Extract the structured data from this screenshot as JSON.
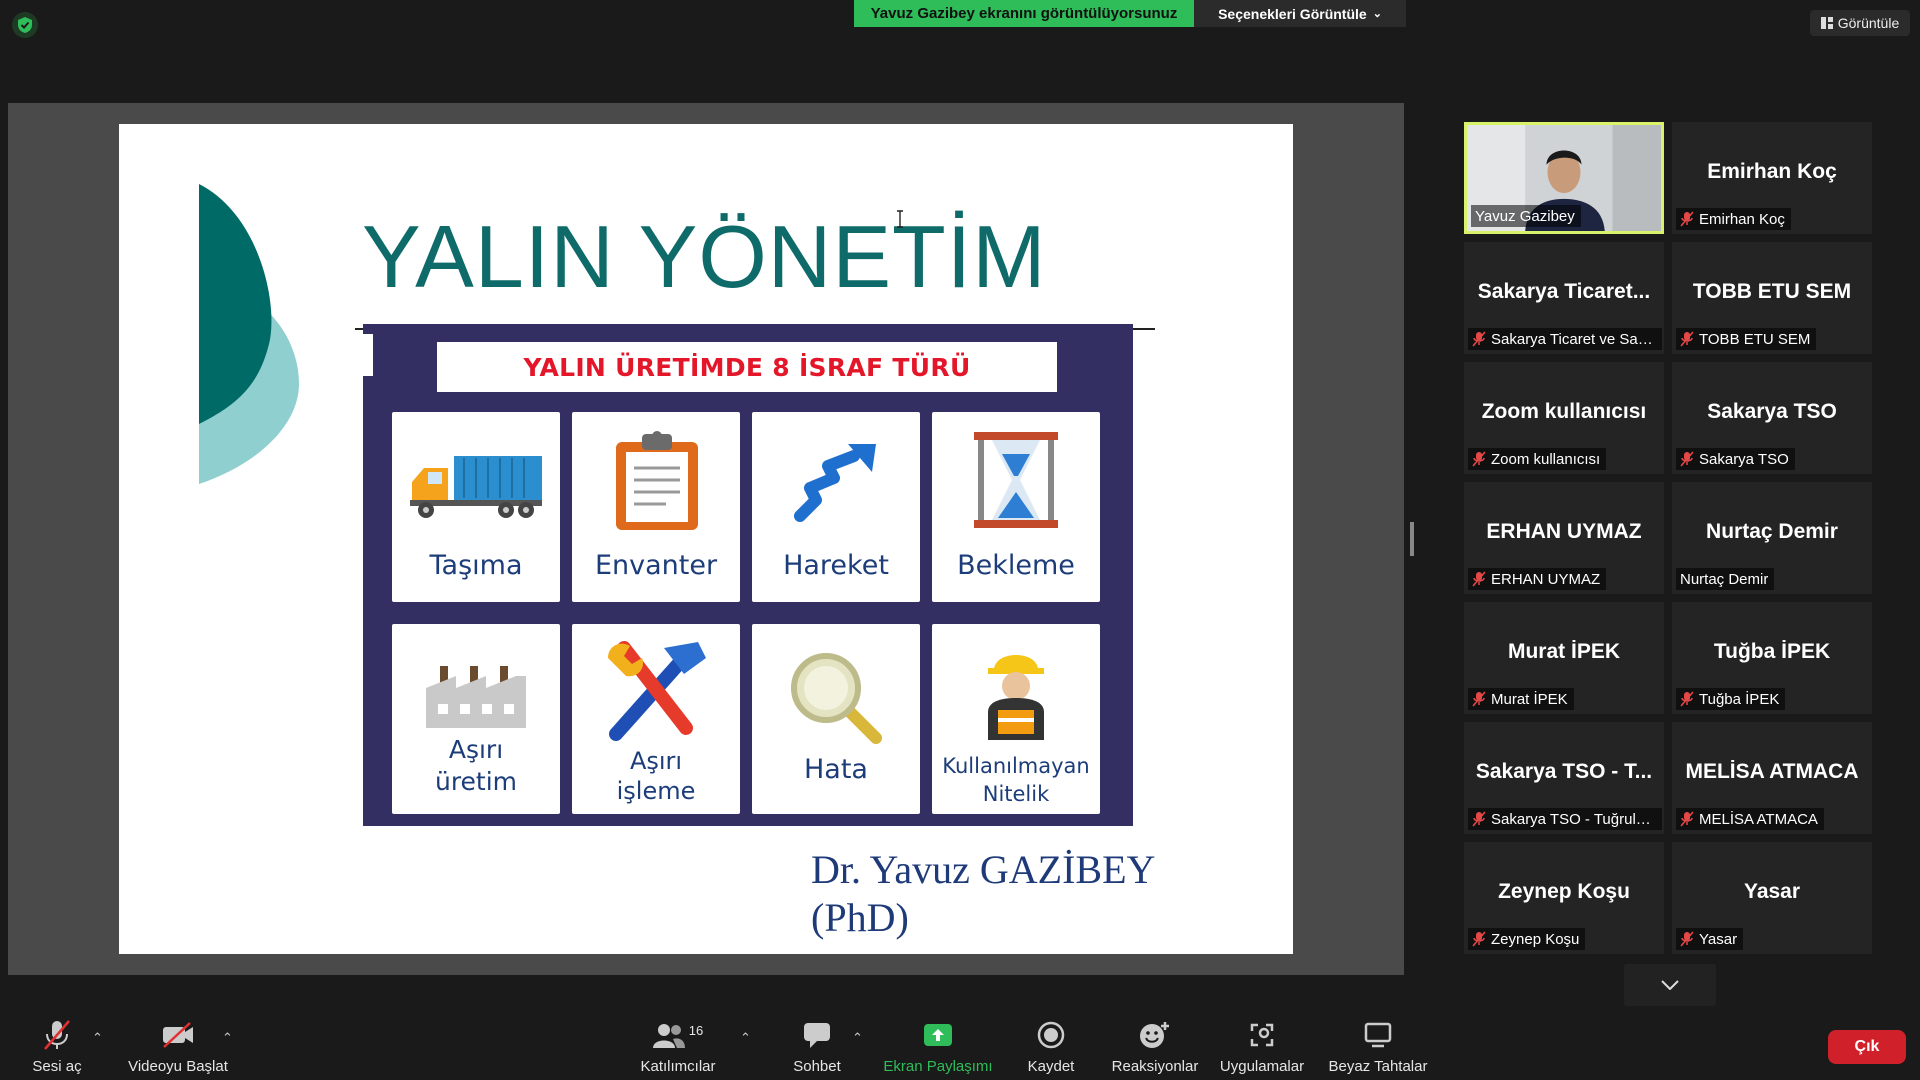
{
  "top_bar": {
    "share_banner": "Yavuz Gazibey ekranını görüntülüyorsunuz",
    "view_options": "Seçenekleri Görüntüle",
    "view_button": "Görüntüle"
  },
  "slide": {
    "title": "YALIN YÖNETİM",
    "panel_header": "YALIN ÜRETİMDE 8 İSRAF TÜRÜ",
    "cards": [
      {
        "label": "Taşıma",
        "icon": "truck-icon"
      },
      {
        "label": "Envanter",
        "icon": "clipboard-icon"
      },
      {
        "label": "Hareket",
        "icon": "zigzag-arrow-icon"
      },
      {
        "label": "Bekleme",
        "icon": "hourglass-icon"
      },
      {
        "label_line1": "Aşırı",
        "label_line2": "üretim",
        "icon": "factory-icon"
      },
      {
        "label_line1": "Aşırı",
        "label_line2": "işleme",
        "icon": "tools-icon"
      },
      {
        "label": "Hata",
        "icon": "magnifier-icon"
      },
      {
        "label_line1": "Kullanılmayan",
        "label_line2": "Nitelik",
        "icon": "worker-icon"
      }
    ],
    "author_line1": "Dr. Yavuz GAZİBEY",
    "author_line2": "(PhD)"
  },
  "gallery": [
    {
      "big": "",
      "tag": "Yavuz Gazibey",
      "muted": false,
      "video": true
    },
    {
      "big": "Emirhan Koç",
      "tag": "Emirhan Koç",
      "muted": true
    },
    {
      "big": "Sakarya  Ticaret...",
      "tag": "Sakarya Ticaret ve San...",
      "muted": true
    },
    {
      "big": "TOBB ETU SEM",
      "tag": "TOBB ETU SEM",
      "muted": true
    },
    {
      "big": "Zoom kullanıcısı",
      "tag": "Zoom kullanıcısı",
      "muted": true
    },
    {
      "big": "Sakarya TSO",
      "tag": "Sakarya TSO",
      "muted": true
    },
    {
      "big": "ERHAN UYMAZ",
      "tag": "ERHAN UYMAZ",
      "muted": true
    },
    {
      "big": "Nurtaç Demir",
      "tag": "Nurtaç Demir",
      "muted": false
    },
    {
      "big": "Murat İPEK",
      "tag": "Murat İPEK",
      "muted": true
    },
    {
      "big": "Tuğba İPEK",
      "tag": "Tuğba İPEK",
      "muted": true
    },
    {
      "big": "Sakarya TSO - T...",
      "tag": "Sakarya TSO - Tuğrulh...",
      "muted": true
    },
    {
      "big": "MELİSA ATMACA",
      "tag": "MELİSA ATMACA",
      "muted": true
    },
    {
      "big": "Zeynep Koşu",
      "tag": "Zeynep Koşu",
      "muted": true
    },
    {
      "big": "Yasar",
      "tag": "Yasar",
      "muted": true
    }
  ],
  "toolbar": {
    "unmute": "Sesi aç",
    "start_video": "Videoyu Başlat",
    "participants": "Katılımcılar",
    "participants_count": "16",
    "chat": "Sohbet",
    "share_screen": "Ekran Paylaşımı",
    "record": "Kaydet",
    "reactions": "Reaksiyonlar",
    "apps": "Uygulamalar",
    "whiteboards": "Beyaz Tahtalar",
    "leave": "Çık"
  },
  "colors": {
    "share_green": "#2ebd59",
    "slide_title": "#0e6b6a",
    "panel_bg": "#332f63",
    "header_red": "#e3162a",
    "active_border": "#d8f26a",
    "leave_red": "#d0202a"
  }
}
